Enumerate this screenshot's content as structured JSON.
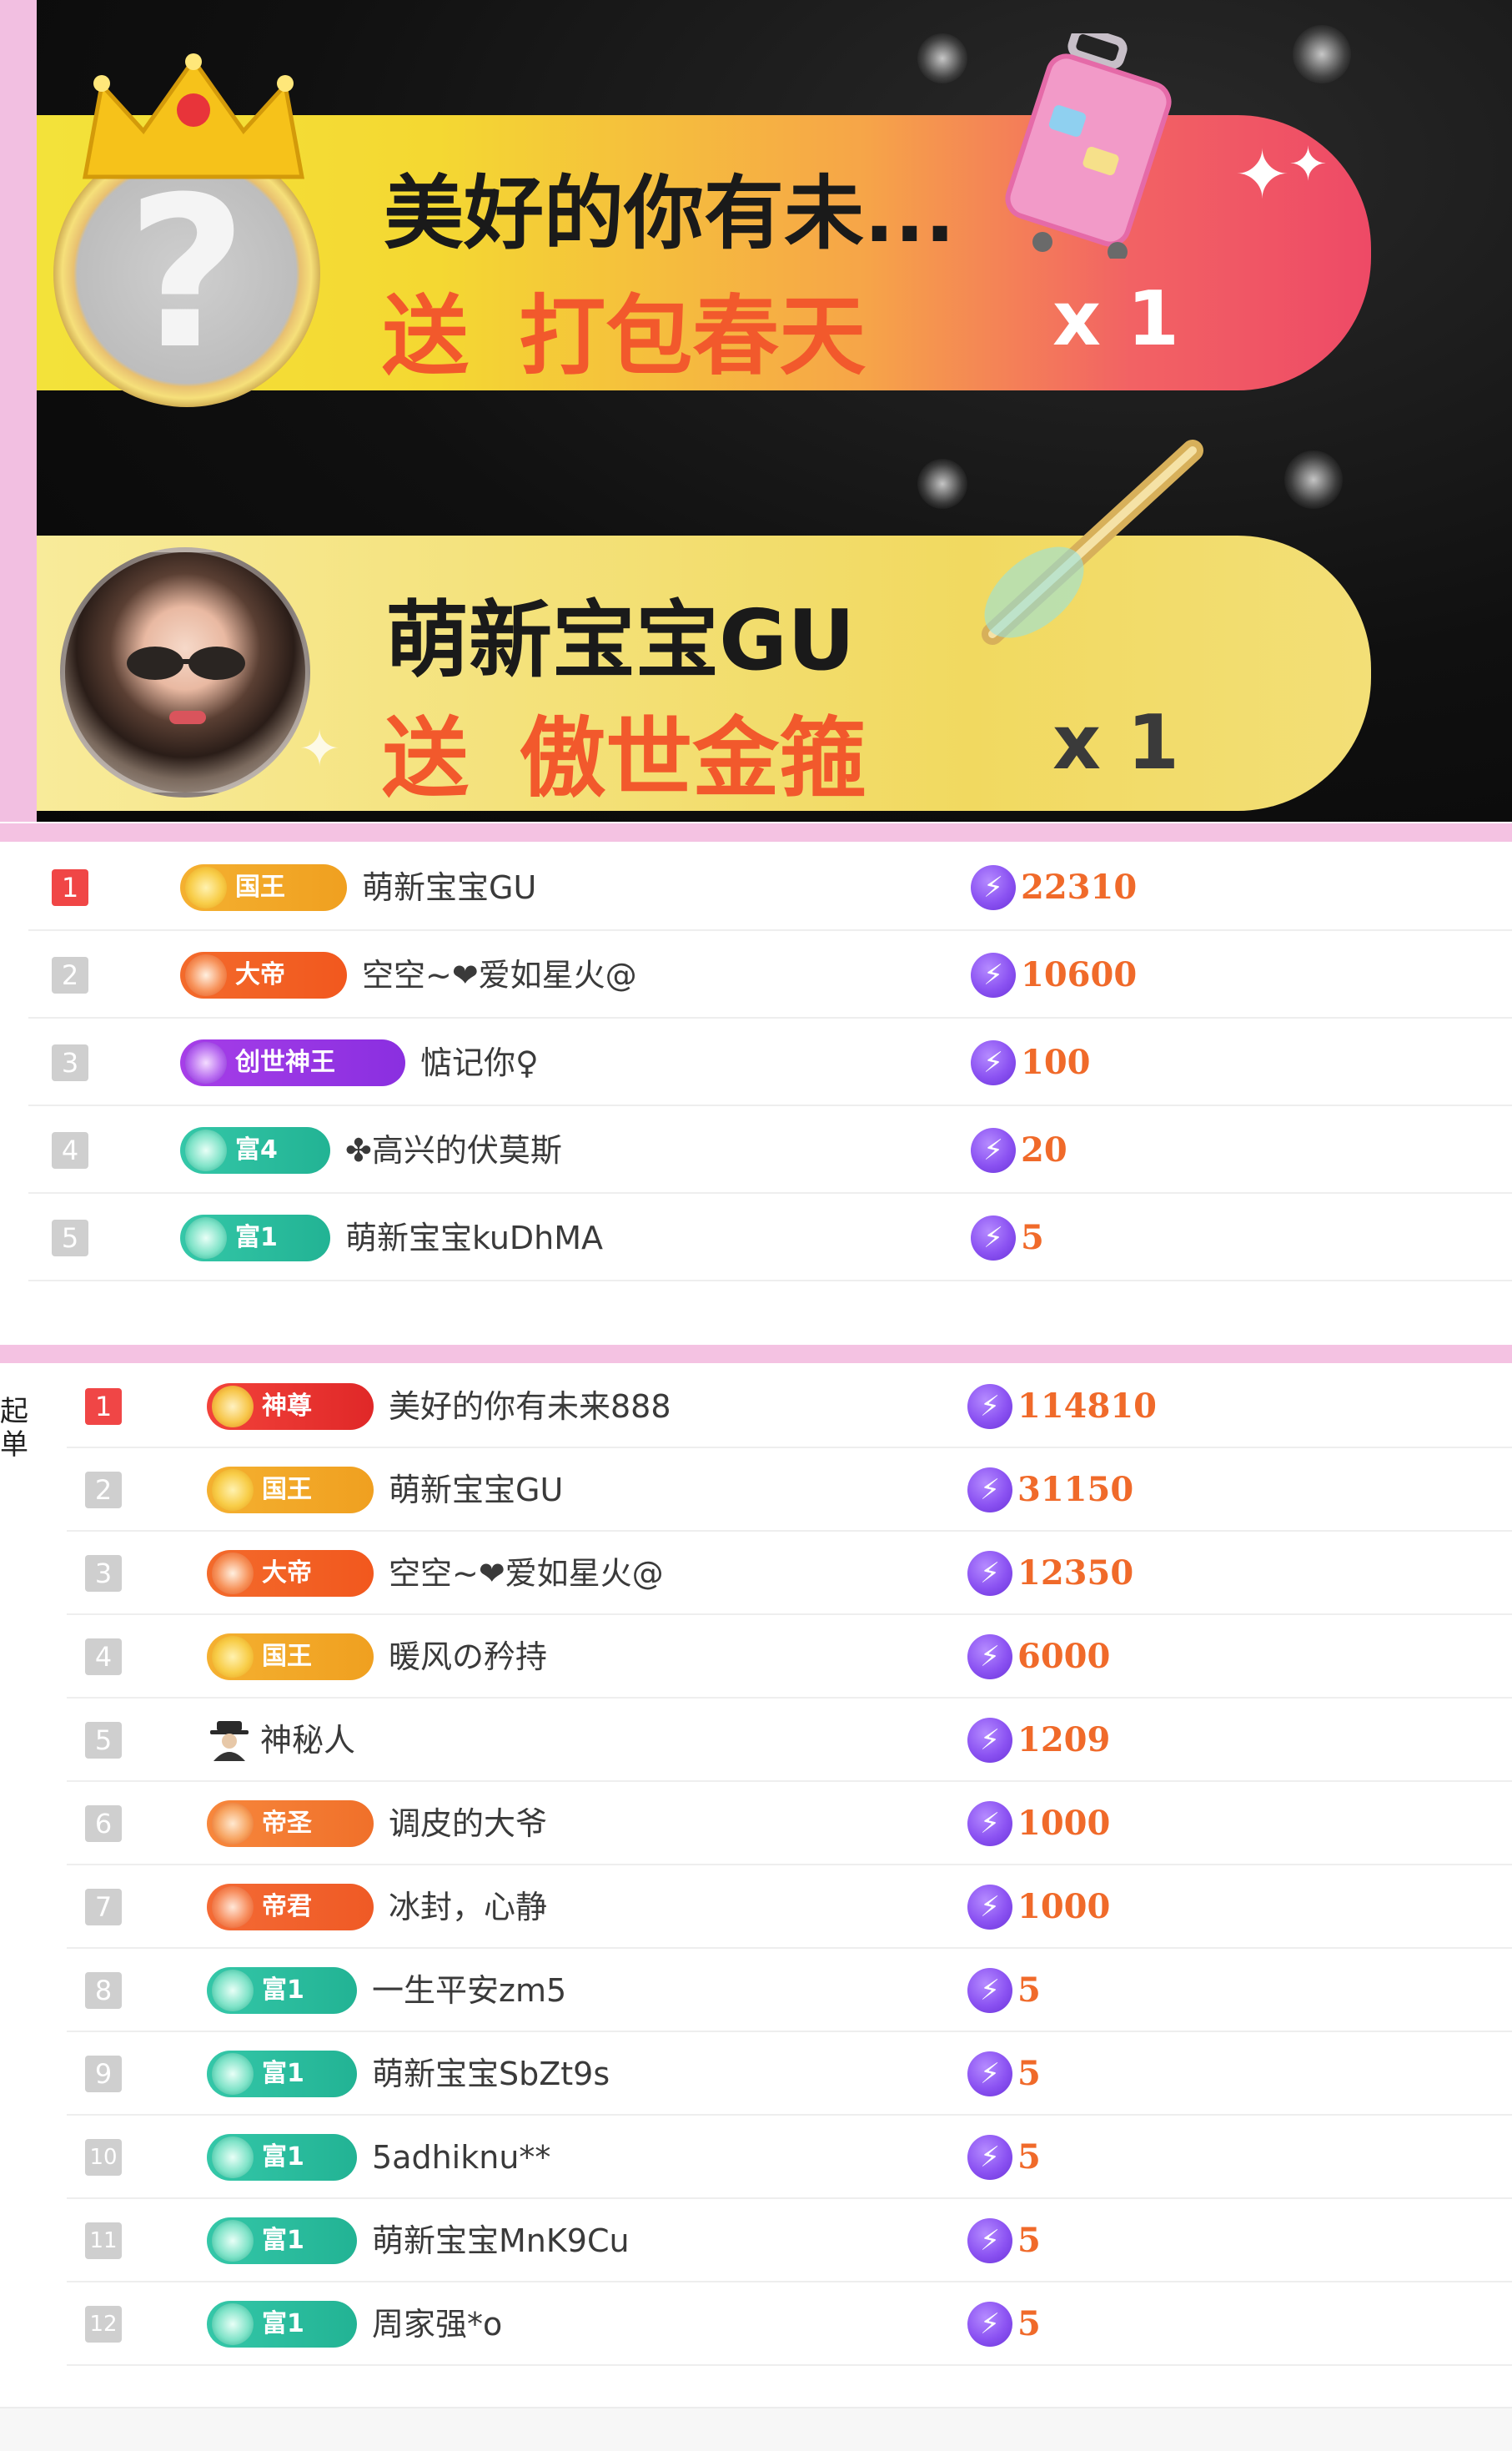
{
  "gift_banners": [
    {
      "sender": "美好的你有未...",
      "action": "送",
      "gift": "打包春天",
      "quantity": "x 1",
      "avatar": "question-mark-avatar",
      "gift_icon": "suitcase-icon"
    },
    {
      "sender": "萌新宝宝GU",
      "action": "送",
      "gift": "傲世金箍",
      "quantity": "x 1",
      "avatar": "user-photo-avatar",
      "gift_icon": "golden-staff-icon"
    }
  ],
  "ranking_panel_1": {
    "rows": [
      {
        "rank": "1",
        "badge_class": "king",
        "badge": "国王",
        "name": "萌新宝宝GU",
        "score": "22310"
      },
      {
        "rank": "2",
        "badge_class": "emperor",
        "badge": "大帝",
        "name": "空空~❤爱如星火@",
        "score": "10600"
      },
      {
        "rank": "3",
        "badge_class": "god",
        "badge": "创世神王",
        "name": "惦记你♀",
        "score": "100"
      },
      {
        "rank": "4",
        "badge_class": "rich",
        "badge": "富4",
        "name": "✤高兴的伏莫斯",
        "score": "20"
      },
      {
        "rank": "5",
        "badge_class": "rich",
        "badge": "富1",
        "name": "萌新宝宝kuDhMA",
        "score": "5"
      }
    ]
  },
  "ranking_panel_2": {
    "side_label": "起单",
    "rows": [
      {
        "rank": "1",
        "badge_class": "zunshen",
        "badge": "神尊",
        "name": "美好的你有未来888",
        "score": "114810"
      },
      {
        "rank": "2",
        "badge_class": "king",
        "badge": "国王",
        "name": "萌新宝宝GU",
        "score": "31150"
      },
      {
        "rank": "3",
        "badge_class": "emperor",
        "badge": "大帝",
        "name": "空空~❤爱如星火@",
        "score": "12350"
      },
      {
        "rank": "4",
        "badge_class": "king",
        "badge": "国王",
        "name": "暖风の矜持",
        "score": "6000"
      },
      {
        "rank": "5",
        "badge_class": "mystery",
        "badge": "",
        "name": "神秘人",
        "score": "1209"
      },
      {
        "rank": "6",
        "badge_class": "disheng",
        "badge": "帝圣",
        "name": "调皮的大爷",
        "score": "1000"
      },
      {
        "rank": "7",
        "badge_class": "dijun",
        "badge": "帝君",
        "name": "冰封，心静",
        "score": "1000"
      },
      {
        "rank": "8",
        "badge_class": "rich",
        "badge": "富1",
        "name": "一生平安zm5",
        "score": "5"
      },
      {
        "rank": "9",
        "badge_class": "rich",
        "badge": "富1",
        "name": "萌新宝宝SbZt9s",
        "score": "5"
      },
      {
        "rank": "10",
        "badge_class": "rich",
        "badge": "富1",
        "name": "5adhiknu**",
        "score": "5"
      },
      {
        "rank": "11",
        "badge_class": "rich",
        "badge": "富1",
        "name": "萌新宝宝MnK9Cu",
        "score": "5"
      },
      {
        "rank": "12",
        "badge_class": "rich",
        "badge": "富1",
        "name": "周家强*o",
        "score": "5"
      }
    ]
  },
  "colors": {
    "accent_pink": "#f4c2e2",
    "score_orange": "#f06a2a",
    "currency_purple": "#8b52f2",
    "first_rank_red": "#f04646"
  },
  "icons": {
    "currency": "lightning-coin-icon",
    "mystery_user": "mystery-person-icon",
    "crown": "crown-icon"
  }
}
